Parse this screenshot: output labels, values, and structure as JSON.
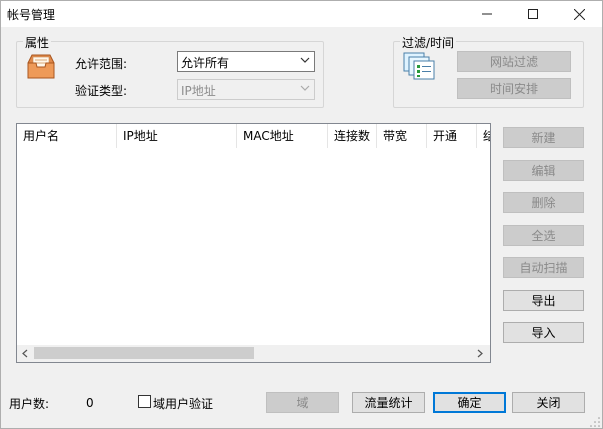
{
  "window": {
    "title": "帐号管理"
  },
  "attributes": {
    "group_label": "属性",
    "allow_range_label": "允许范围:",
    "allow_range_value": "允许所有",
    "auth_type_label": "验证类型:",
    "auth_type_value": "IP地址"
  },
  "filter": {
    "group_label": "过滤/时间",
    "website_filter": "网站过滤",
    "schedule": "时间安排"
  },
  "table": {
    "columns": [
      "用户名",
      "IP地址",
      "MAC地址",
      "连接数",
      "带宽",
      "开通",
      "结"
    ]
  },
  "side_buttons": {
    "new": "新建",
    "edit": "编辑",
    "delete": "删除",
    "select_all": "全选",
    "auto_scan": "自动扫描",
    "export": "导出",
    "import": "导入"
  },
  "footer": {
    "user_count_label": "用户数:",
    "user_count_value": "0",
    "domain_auth_label": "域用户验证",
    "domain_button": "域",
    "traffic_stats": "流量统计",
    "ok": "确定",
    "close": "关闭"
  }
}
